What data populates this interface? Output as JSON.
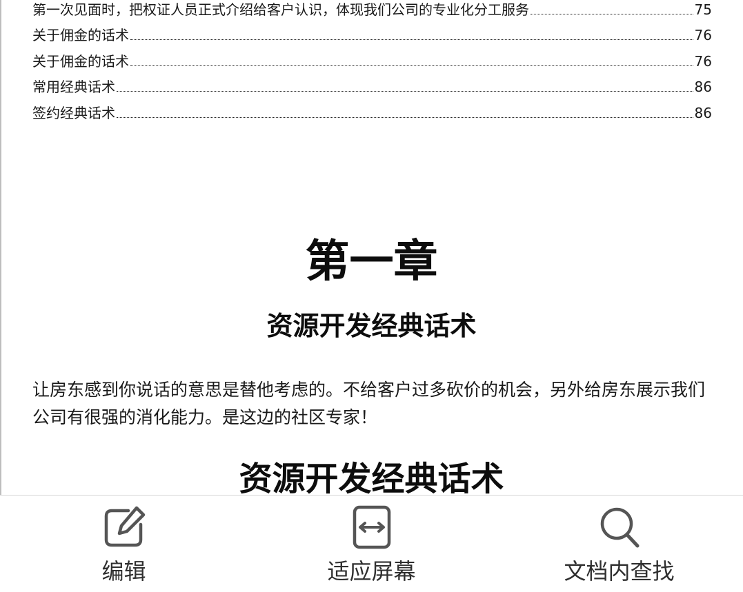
{
  "document": {
    "toc": [
      {
        "title": "第一次见面时，把权证人员正式介绍给客户认识，体现我们公司的专业化分工服务",
        "page": "75"
      },
      {
        "title": "关于佣金的话术",
        "page": "76"
      },
      {
        "title": "关于佣金的话术",
        "page": "76"
      },
      {
        "title": "常用经典话术",
        "page": "86"
      },
      {
        "title": "签约经典话术",
        "page": "86"
      }
    ],
    "chapter_heading": "第一章",
    "chapter_subheading": "资源开发经典话术",
    "paragraph": "让房东感到你说话的意思是替他考虑的。不给客户过多砍价的机会，另外给房东展示我们公司有很强的消化能力。是这边的社区专家！",
    "section_heading": "资源开发经典话术"
  },
  "toolbar": {
    "edit": {
      "label": "编辑",
      "icon": "edit-icon"
    },
    "fit_screen": {
      "label": "适应屏幕",
      "icon": "fit-width-icon"
    },
    "find_in_doc": {
      "label": "文档内查找",
      "icon": "search-icon"
    }
  },
  "colors": {
    "icon": "#555555",
    "text": "#1a1a1a",
    "divider": "#d6d6d6"
  }
}
